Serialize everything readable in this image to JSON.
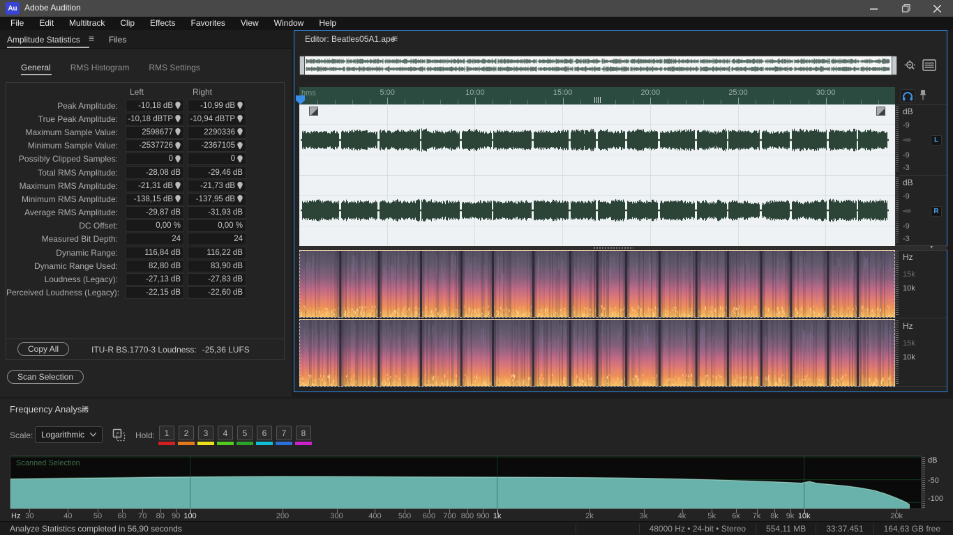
{
  "window": {
    "logo": "Au",
    "title": "Adobe Audition"
  },
  "menu": {
    "items": [
      "File",
      "Edit",
      "Multitrack",
      "Clip",
      "Effects",
      "Favorites",
      "View",
      "Window",
      "Help"
    ]
  },
  "stats_panel": {
    "title": "Amplitude Statistics",
    "files_tab": "Files",
    "subtabs": [
      {
        "label": "General",
        "active": true
      },
      {
        "label": "RMS Histogram",
        "active": false
      },
      {
        "label": "RMS Settings",
        "active": false
      }
    ],
    "columns": {
      "left": "Left",
      "right": "Right"
    },
    "rows": [
      {
        "label": "Peak Amplitude:",
        "left": "-10,18 dB",
        "right": "-10,99 dB",
        "pin": true
      },
      {
        "label": "True Peak Amplitude:",
        "left": "-10,18 dBTP",
        "right": "-10,94 dBTP",
        "pin": true
      },
      {
        "label": "Maximum Sample Value:",
        "left": "2598677",
        "right": "2290336",
        "pin": true
      },
      {
        "label": "Minimum Sample Value:",
        "left": "-2537726",
        "right": "-2367105",
        "pin": true
      },
      {
        "label": "Possibly Clipped Samples:",
        "left": "0",
        "right": "0",
        "pin": true
      },
      {
        "label": "Total RMS Amplitude:",
        "left": "-28,08 dB",
        "right": "-29,46 dB",
        "pin": false
      },
      {
        "label": "Maximum RMS Amplitude:",
        "left": "-21,31 dB",
        "right": "-21,73 dB",
        "pin": true
      },
      {
        "label": "Minimum RMS Amplitude:",
        "left": "-138,15 dB",
        "right": "-137,95 dB",
        "pin": true
      },
      {
        "label": "Average RMS Amplitude:",
        "left": "-29,87 dB",
        "right": "-31,93 dB",
        "pin": false
      },
      {
        "label": "DC Offset:",
        "left": "0,00 %",
        "right": "0,00 %",
        "pin": false
      },
      {
        "label": "Measured Bit Depth:",
        "left": "24",
        "right": "24",
        "pin": false
      },
      {
        "label": "Dynamic Range:",
        "left": "116,84 dB",
        "right": "116,22 dB",
        "pin": false
      },
      {
        "label": "Dynamic Range Used:",
        "left": "82,80 dB",
        "right": "83,90 dB",
        "pin": false
      },
      {
        "label": "Loudness (Legacy):",
        "left": "-27,13 dB",
        "right": "-27,83 dB",
        "pin": false
      },
      {
        "label": "Perceived Loudness (Legacy):",
        "left": "-22,15 dB",
        "right": "-22,60 dB",
        "pin": false
      }
    ],
    "copy_all": "Copy All",
    "loudness_label": "ITU-R BS.1770-3 Loudness:",
    "loudness_value": "-25,36 LUFS",
    "scan_selection": "Scan Selection"
  },
  "editor": {
    "title": "Editor: Beatles05A1.ape",
    "ruler_unit": "hms",
    "time_ticks": [
      {
        "label": "5:00",
        "min": 5
      },
      {
        "label": "10:00",
        "min": 10
      },
      {
        "label": "15:00",
        "min": 15
      },
      {
        "label": "20:00",
        "min": 20
      },
      {
        "label": "25:00",
        "min": 25
      },
      {
        "label": "30:00",
        "min": 30
      }
    ],
    "wave_scale_unit": "dB",
    "wave_scale_marks": [
      "-9",
      "-∞",
      "-9",
      "-3"
    ],
    "channel_badges": [
      "L",
      "R"
    ],
    "spec_scale_unit": "Hz",
    "spec_scale_marks": [
      "15k",
      "10k"
    ]
  },
  "freq_panel": {
    "title": "Frequency Analysis",
    "scale_label": "Scale:",
    "scale_value": "Logarithmic",
    "hold_label": "Hold:",
    "hold_buttons": [
      {
        "n": "1",
        "color": "#d21f1f"
      },
      {
        "n": "2",
        "color": "#e2791f"
      },
      {
        "n": "3",
        "color": "#e8e11c"
      },
      {
        "n": "4",
        "color": "#52cc1e"
      },
      {
        "n": "5",
        "color": "#2aa52a"
      },
      {
        "n": "6",
        "color": "#12bcd4"
      },
      {
        "n": "7",
        "color": "#2b6fd8"
      },
      {
        "n": "8",
        "color": "#cc22cc"
      }
    ],
    "plot_label": "Scanned Selection",
    "y_axis": {
      "unit": "dB",
      "labels": [
        "-50",
        "-100"
      ]
    },
    "x_axis_unit": "Hz"
  },
  "chart_data": {
    "type": "area",
    "title": "Frequency Analysis — Scanned Selection",
    "xlabel": "Hz",
    "ylabel": "dB",
    "x_scale": "log",
    "xlim": [
      26,
      24000
    ],
    "ylim": [
      -110,
      0
    ],
    "legend": "none",
    "grid": {
      "x_major": [
        100,
        1000,
        10000
      ],
      "y_major": [
        0,
        -50,
        -100
      ]
    },
    "x_axis": {
      "ticks": [
        {
          "label": "30",
          "f": 30,
          "major": false
        },
        {
          "label": "40",
          "f": 40,
          "major": false
        },
        {
          "label": "50",
          "f": 50,
          "major": false
        },
        {
          "label": "60",
          "f": 60,
          "major": false
        },
        {
          "label": "70",
          "f": 70,
          "major": false
        },
        {
          "label": "80",
          "f": 80,
          "major": false
        },
        {
          "label": "90",
          "f": 90,
          "major": false
        },
        {
          "label": "100",
          "f": 100,
          "major": true
        },
        {
          "label": "200",
          "f": 200,
          "major": false
        },
        {
          "label": "300",
          "f": 300,
          "major": false
        },
        {
          "label": "400",
          "f": 400,
          "major": false
        },
        {
          "label": "500",
          "f": 500,
          "major": false
        },
        {
          "label": "600",
          "f": 600,
          "major": false
        },
        {
          "label": "700",
          "f": 700,
          "major": false
        },
        {
          "label": "800",
          "f": 800,
          "major": false
        },
        {
          "label": "900",
          "f": 900,
          "major": false
        },
        {
          "label": "1k",
          "f": 1000,
          "major": true
        },
        {
          "label": "2k",
          "f": 2000,
          "major": false
        },
        {
          "label": "3k",
          "f": 3000,
          "major": false
        },
        {
          "label": "4k",
          "f": 4000,
          "major": false
        },
        {
          "label": "5k",
          "f": 5000,
          "major": false
        },
        {
          "label": "6k",
          "f": 6000,
          "major": false
        },
        {
          "label": "7k",
          "f": 7000,
          "major": false
        },
        {
          "label": "8k",
          "f": 8000,
          "major": false
        },
        {
          "label": "9k",
          "f": 9000,
          "major": false
        },
        {
          "label": "10k",
          "f": 10000,
          "major": true
        },
        {
          "label": "20k",
          "f": 20000,
          "major": false
        }
      ]
    },
    "series": [
      {
        "name": "Left",
        "points": [
          [
            26,
            -47.5
          ],
          [
            40,
            -46
          ],
          [
            60,
            -44.8
          ],
          [
            80,
            -43.8
          ],
          [
            100,
            -43.2
          ],
          [
            150,
            -42.6
          ],
          [
            200,
            -42.2
          ],
          [
            300,
            -42.6
          ],
          [
            400,
            -43
          ],
          [
            500,
            -43.3
          ],
          [
            700,
            -43.8
          ],
          [
            900,
            -44
          ],
          [
            1200,
            -44.3
          ],
          [
            1600,
            -44.8
          ],
          [
            2000,
            -45.2
          ],
          [
            2600,
            -46
          ],
          [
            3200,
            -47
          ],
          [
            4000,
            -48.2
          ],
          [
            5000,
            -50
          ],
          [
            6000,
            -51.8
          ],
          [
            7000,
            -53.2
          ],
          [
            8000,
            -54.8
          ],
          [
            9000,
            -56.2
          ],
          [
            9800,
            -57.2
          ],
          [
            10400,
            -53.5
          ],
          [
            11000,
            -57.5
          ],
          [
            12000,
            -60
          ],
          [
            13500,
            -63
          ],
          [
            15000,
            -67
          ],
          [
            16500,
            -72
          ],
          [
            18000,
            -79
          ],
          [
            19500,
            -87
          ],
          [
            21000,
            -96
          ],
          [
            22000,
            -104
          ]
        ]
      },
      {
        "name": "Right",
        "points": [
          [
            26,
            -49
          ],
          [
            40,
            -47.3
          ],
          [
            60,
            -46
          ],
          [
            80,
            -45
          ],
          [
            100,
            -44.3
          ],
          [
            150,
            -43.6
          ],
          [
            200,
            -43.2
          ],
          [
            300,
            -43.4
          ],
          [
            400,
            -43.7
          ],
          [
            500,
            -44
          ],
          [
            700,
            -44.3
          ],
          [
            900,
            -44.5
          ],
          [
            1200,
            -44.8
          ],
          [
            1600,
            -45.2
          ],
          [
            2000,
            -45.6
          ],
          [
            2600,
            -46.4
          ],
          [
            3200,
            -47.4
          ],
          [
            4000,
            -48.6
          ],
          [
            5000,
            -50.3
          ],
          [
            6000,
            -52
          ],
          [
            7000,
            -53.5
          ],
          [
            8000,
            -55
          ],
          [
            9000,
            -56.5
          ],
          [
            9800,
            -57.5
          ],
          [
            10400,
            -54
          ],
          [
            11000,
            -58
          ],
          [
            12000,
            -60.5
          ],
          [
            13500,
            -63.5
          ],
          [
            15000,
            -67.5
          ],
          [
            17000,
            -74
          ],
          [
            18500,
            -82
          ],
          [
            20000,
            -91
          ],
          [
            21500,
            -100
          ],
          [
            22000,
            -105
          ]
        ]
      }
    ]
  },
  "status_bar": {
    "message": "Analyze Statistics completed in 56,90 seconds",
    "format": "48000 Hz • 24-bit • Stereo",
    "file_size": "554,11 MB",
    "duration": "33:37.451",
    "disk_free": "164,63 GB free"
  },
  "colors": {
    "accent_blue": "#2f8fe9",
    "panel_bg": "#232323",
    "timeline_bg": "#2b4a40",
    "waveform_green": "#2c4437",
    "wave_bg": "#eef2f5",
    "freq_fill_teal": "#68b2ab",
    "freq_line_dark_green": "#2b5a44",
    "spectrogram_palette": [
      "#565062",
      "#87607c",
      "#c06a85",
      "#ef9257",
      "#f7c46a"
    ]
  }
}
